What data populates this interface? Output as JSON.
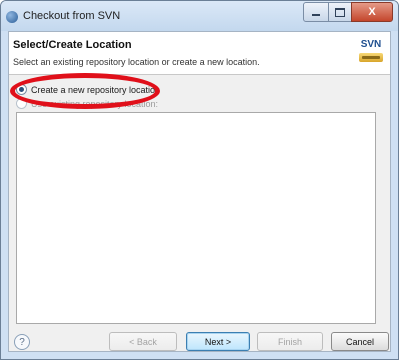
{
  "window": {
    "title": "Checkout from SVN",
    "close_glyph": "X"
  },
  "header": {
    "title": "Select/Create Location",
    "description": "Select an existing repository location or create a new location.",
    "logo_text": "SVN"
  },
  "options": [
    {
      "label": "Create a new repository location",
      "selected": true
    },
    {
      "label": "Use existing repository location:",
      "selected": false
    }
  ],
  "footer": {
    "help_glyph": "?",
    "back_label": "< Back",
    "next_label": "Next >",
    "finish_label": "Finish",
    "cancel_label": "Cancel"
  },
  "colors": {
    "annotation": "#e0101a",
    "title_bar": "#c3d8ee"
  }
}
